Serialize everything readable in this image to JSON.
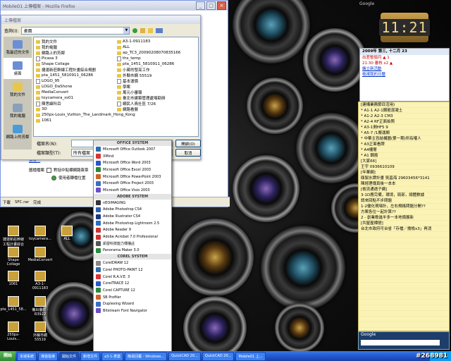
{
  "window": {
    "title": "MobileO1 上傳檔案 - Mozilla Firefox",
    "buttons": [
      "_",
      "□",
      "×"
    ]
  },
  "dialog": {
    "title": "上傳檔案",
    "lookin_label": "查詢(I):",
    "lookin_value": "桌面",
    "places": [
      "我最近的文件",
      "桌面",
      "我的文件",
      "我的電腦",
      "網路上的芳鄰"
    ],
    "files_col1": [
      "我的文件",
      "我的電腦",
      "網路上的芳鄰",
      "Picasa 3",
      "Shape Collage",
      "捷運新莊幹線工程計畫綜合規劃",
      "pta_1451_5810911_06286",
      "LOGO_95",
      "LOGO_DaShone",
      "MediaConvert",
      "toycamera_ss01",
      "陳思緯科目",
      "3D",
      "250px-Louis_Vuitton_The_Landmark_Hong_Kong",
      "1061"
    ],
    "files_col2": [
      "A3-1-0911183",
      "ALL",
      "ap_TC3_20090208070835166",
      "ths_temp",
      "pta_1451_5810911_06286",
      "小蔣的發亮工作",
      "外縣市網 55519",
      "基本運價",
      "學案",
      "萬元小審報",
      "臺北市建築管理處場勘辦",
      "網民人員社區 7/26",
      "網路看展"
    ],
    "filename_label": "檔案名(N):",
    "filetype_label": "檔案類型(T):",
    "filetype_value": "所有檔案",
    "open_label": "開啟(O)",
    "cancel_label": "取消"
  },
  "behind": {
    "row1": "瀏覽...",
    "row2_label": "圖檔檔案",
    "row2_opt1": "對話中貼標網路簽章",
    "row2_opt2": "使用者轉檔位置"
  },
  "statusbar": {
    "items": [
      "下載",
      "SFC.rar",
      "完成"
    ]
  },
  "menu": {
    "sections": [
      {
        "head": "OFFICE SYSTEM",
        "items": [
          "Microsoft Office Outlook 2007",
          "XMind",
          "Microsoft Office Word 2003",
          "Microsoft Office Excel 2003",
          "Microsoft Office PowerPoint 2003",
          "Microsoft Office Project 2003",
          "Microsoft Office Visio 2003"
        ]
      },
      {
        "head": "ADOBE SYSTEM",
        "items": [
          "nEOiMAGING",
          "Adobe Photoshop CS4",
          "Adobe Illustrator CS4",
          "Adobe Photoshop Lightroom 2.5",
          "Adobe Reader 9",
          "Adobe Acrobat 7.0 Professional",
          "凱發科技能力傳播註",
          "Panorama Maker 3.0"
        ]
      },
      {
        "head": "COREL SYSTEM",
        "items": [
          "CorelDRAW 12",
          "Corel PHOTO-PAINT 12",
          "Corel R.A.V.E. 3",
          "CorelTRACE 12",
          "Corel CAPTURE 12",
          "SB Profiler",
          "Duplexing Wizard",
          "Bitstream Font Navigator"
        ]
      }
    ]
  },
  "desktop_icons": [
    {
      "label": "捷運新莊幹線工程計畫綜合規劃"
    },
    {
      "label": "toycamera..."
    },
    {
      "label": "ALL"
    },
    {
      "label": "Shape Collage"
    },
    {
      "label": "MediaConvert"
    },
    {
      "label": "1061"
    },
    {
      "label": "A3-1-0911183"
    },
    {
      "label": "pta_1451_58..."
    },
    {
      "label": "備出優標 -R3922"
    },
    {
      "label": "250px-Louis..."
    },
    {
      "label": "外縣市網 55519"
    }
  ],
  "taskbar": {
    "start": "開始",
    "tasks": [
      "本城系統",
      "導遊指導",
      "開始文件",
      "新增文件",
      "a3-1-表案",
      "簡易回覆 - Windows...",
      "QuickCAD 20...",
      "QuickCAD 20...",
      "Mobile01 上..."
    ],
    "active_index": 2
  },
  "google_label": "Google",
  "clock": {
    "time": "11:21"
  },
  "calendar": {
    "header": "2009年 第三, 十二月 23",
    "events": [
      "出差暫個月 ▲ 1",
      "21:30 審核 x2 ▲"
    ],
    "links": [
      "議立新活動",
      "檢視我的日曆"
    ]
  },
  "notes": [
    "[建構業務節目活用)",
    "* A1-1 A2-1鋼筋混凝土",
    "* A1-2 A2-3 CM3",
    "* A2-4 RF正面拍照",
    "* A3-1側HF5 9",
    "* A5-7 /1搬運網",
    "* 中華主旨結構圖(第一期)所有權人",
    "* A3正面看牌",
    "* A4樓層",
    "* A1 鋼筋",
    "",
    "[大家66]",
    "王宇 0936610109",
    "",
    "[年華網]",
    "鼎製水牌計畫 吳昌海 29603456*3141",
    "陳經理傳真後一本本",
    "",
    "[檢流通遇子網]",
    "3-1D應完備，環境，局部，總體數據",
    "請來回點不步問題",
    "1-2優化現場計，左右規格問題分開??",
    "方案各位一起計算??",
    "",
    "2 - 創業歌進半多一本地價展新",
    "",
    "[共屋屋標號]",
    "台北市政府可台省「存檔／擔檢x3」再消"
  ],
  "google_search_label": "Google",
  "watermark": "#268981"
}
